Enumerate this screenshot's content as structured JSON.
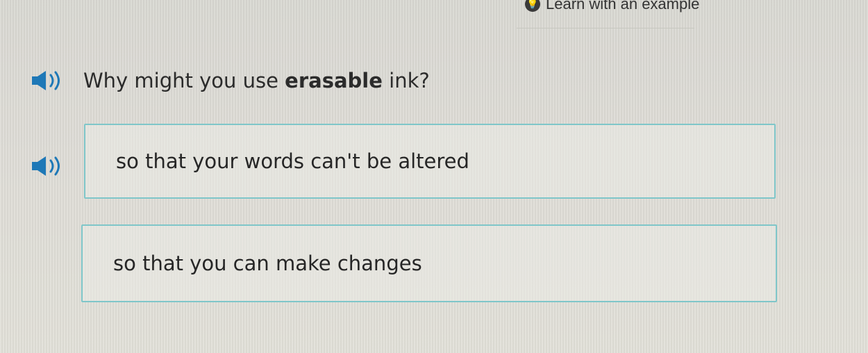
{
  "header": {
    "learn_label": "Learn with an example"
  },
  "question": {
    "prefix": "Why might you use ",
    "emphasis": "erasable",
    "suffix": " ink?"
  },
  "answers": [
    {
      "label": "so that your words can't be altered"
    },
    {
      "label": "so that you can make changes"
    }
  ],
  "colors": {
    "answer_border": "#7fc6c9",
    "speaker_icon": "#1e78b7"
  },
  "icons": {
    "learn": "lightbulb-icon",
    "audio": "speaker-icon"
  }
}
